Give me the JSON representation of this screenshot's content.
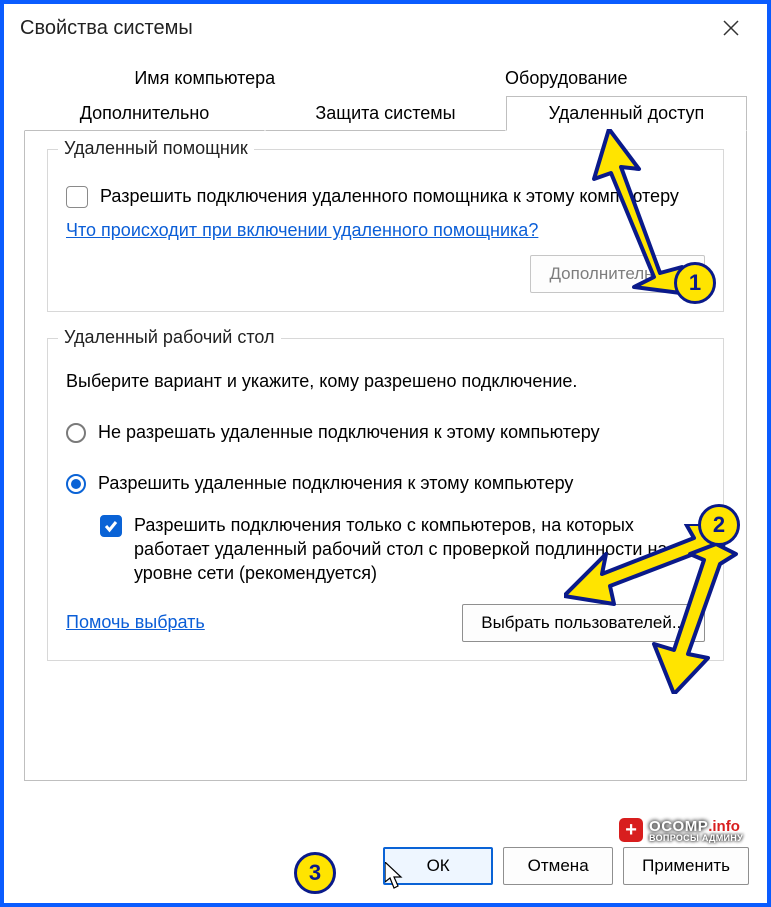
{
  "titlebar": {
    "title": "Свойства системы"
  },
  "tabs": {
    "row1": [
      {
        "label": "Имя компьютера"
      },
      {
        "label": "Оборудование"
      }
    ],
    "row2": [
      {
        "label": "Дополнительно"
      },
      {
        "label": "Защита системы"
      },
      {
        "label": "Удаленный доступ",
        "active": true
      }
    ]
  },
  "group_assist": {
    "legend": "Удаленный помощник",
    "checkbox_label": "Разрешить подключения удаленного помощника к этому компьютеру",
    "help_link": "Что происходит при включении удаленного помощника?",
    "advanced_btn": "Дополнительно..."
  },
  "group_desktop": {
    "legend": "Удаленный рабочий стол",
    "desc": "Выберите вариант и укажите, кому разрешено подключение.",
    "radio_deny": "Не разрешать удаленные подключения к этому компьютеру",
    "radio_allow": "Разрешить удаленные подключения к этому компьютеру",
    "checkbox_nla": "Разрешить подключения только с компьютеров, на которых работает удаленный рабочий стол с проверкой подлинности на уровне сети (рекомендуется)",
    "help_link": "Помочь выбрать",
    "select_users_btn": "Выбрать пользователей..."
  },
  "dialog_buttons": {
    "ok": "ОК",
    "cancel": "Отмена",
    "apply": "Применить"
  },
  "annotations": {
    "badge1": "1",
    "badge2": "2",
    "badge3": "3",
    "logo_main": "OCOMP",
    "logo_info": ".info",
    "logo_sub": "ВОПРОСЫ АДМИНУ"
  }
}
